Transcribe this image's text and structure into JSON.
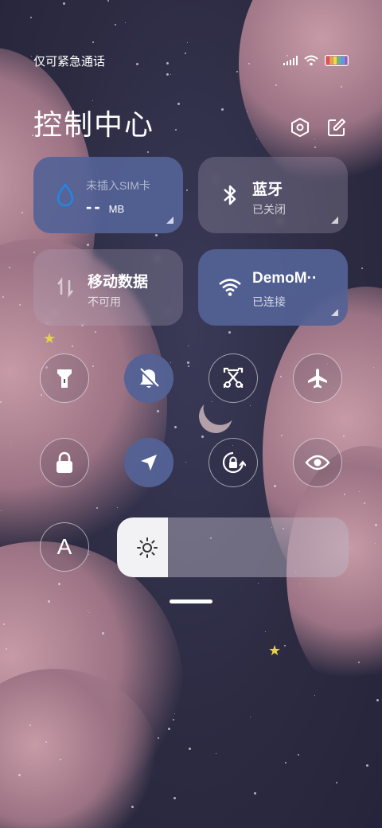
{
  "status_bar": {
    "carrier": "仅可紧急通话"
  },
  "header": {
    "title": "控制中心"
  },
  "tiles": {
    "sim": {
      "label": "未插入SIM卡",
      "value": "--",
      "unit": "MB"
    },
    "bluetooth": {
      "label": "蓝牙",
      "status": "已关闭"
    },
    "mobile_data": {
      "label": "移动数据",
      "status": "不可用"
    },
    "wifi": {
      "label": "DemoM··",
      "status": "已连接"
    }
  },
  "toggles": {
    "font_size_label": "A"
  },
  "brightness": {
    "level": 0.22
  },
  "colors": {
    "active_tile": "#5462a0",
    "sim_drop": "#1e88e5"
  }
}
